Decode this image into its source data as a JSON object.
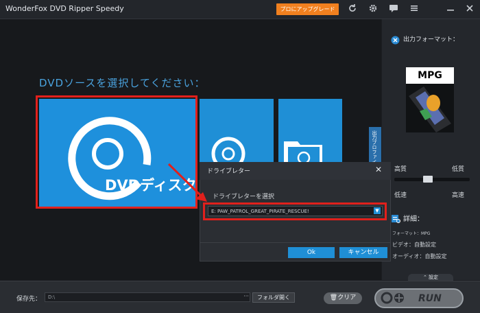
{
  "window": {
    "title": "WonderFox DVD Ripper Speedy"
  },
  "toolbar": {
    "upgrade_label": "プロにアップグレード",
    "icons": [
      "refresh-icon",
      "gear-icon",
      "chat-icon",
      "menu-icon",
      "minimize-icon",
      "close-icon"
    ]
  },
  "main": {
    "heading": "DVDソースを選択してください：",
    "dvd_tile_label": "DVDディスク"
  },
  "right_panel": {
    "output_format_title": "出力フォーマット：",
    "format_thumb_label": "MPG",
    "profile_tab": "出力プロファイル",
    "quality_high": "高質",
    "quality_low": "低質",
    "speed_low": "低速",
    "speed_high": "高速",
    "quality_level_fraction": 0.5,
    "details_title": "詳細：",
    "format_row": "フォーマット：MPG",
    "video_row": "ビデオ：自動設定",
    "audio_row": "オーディオ：自動設定",
    "settings_label": "設定"
  },
  "bottom": {
    "save_to_label": "保存先：",
    "path_value": "D:\\",
    "more_label": "···",
    "open_folder_label": "フォルダ開く",
    "clear_label": "クリア",
    "run_label": "RUN"
  },
  "dialog": {
    "title": "ドライブレター",
    "close_glyph": "✕",
    "select_label": "ドライブレターを選択",
    "selected_drive": "E:  PAW_PATROL_GREAT_PIRATE_RESCUE!",
    "ok_label": "Ok",
    "cancel_label": "キャンセル"
  },
  "colors": {
    "accent_blue": "#1f8fd6",
    "upgrade_orange": "#f1801f",
    "highlight_red": "#e1201c",
    "background": "#17191c"
  }
}
